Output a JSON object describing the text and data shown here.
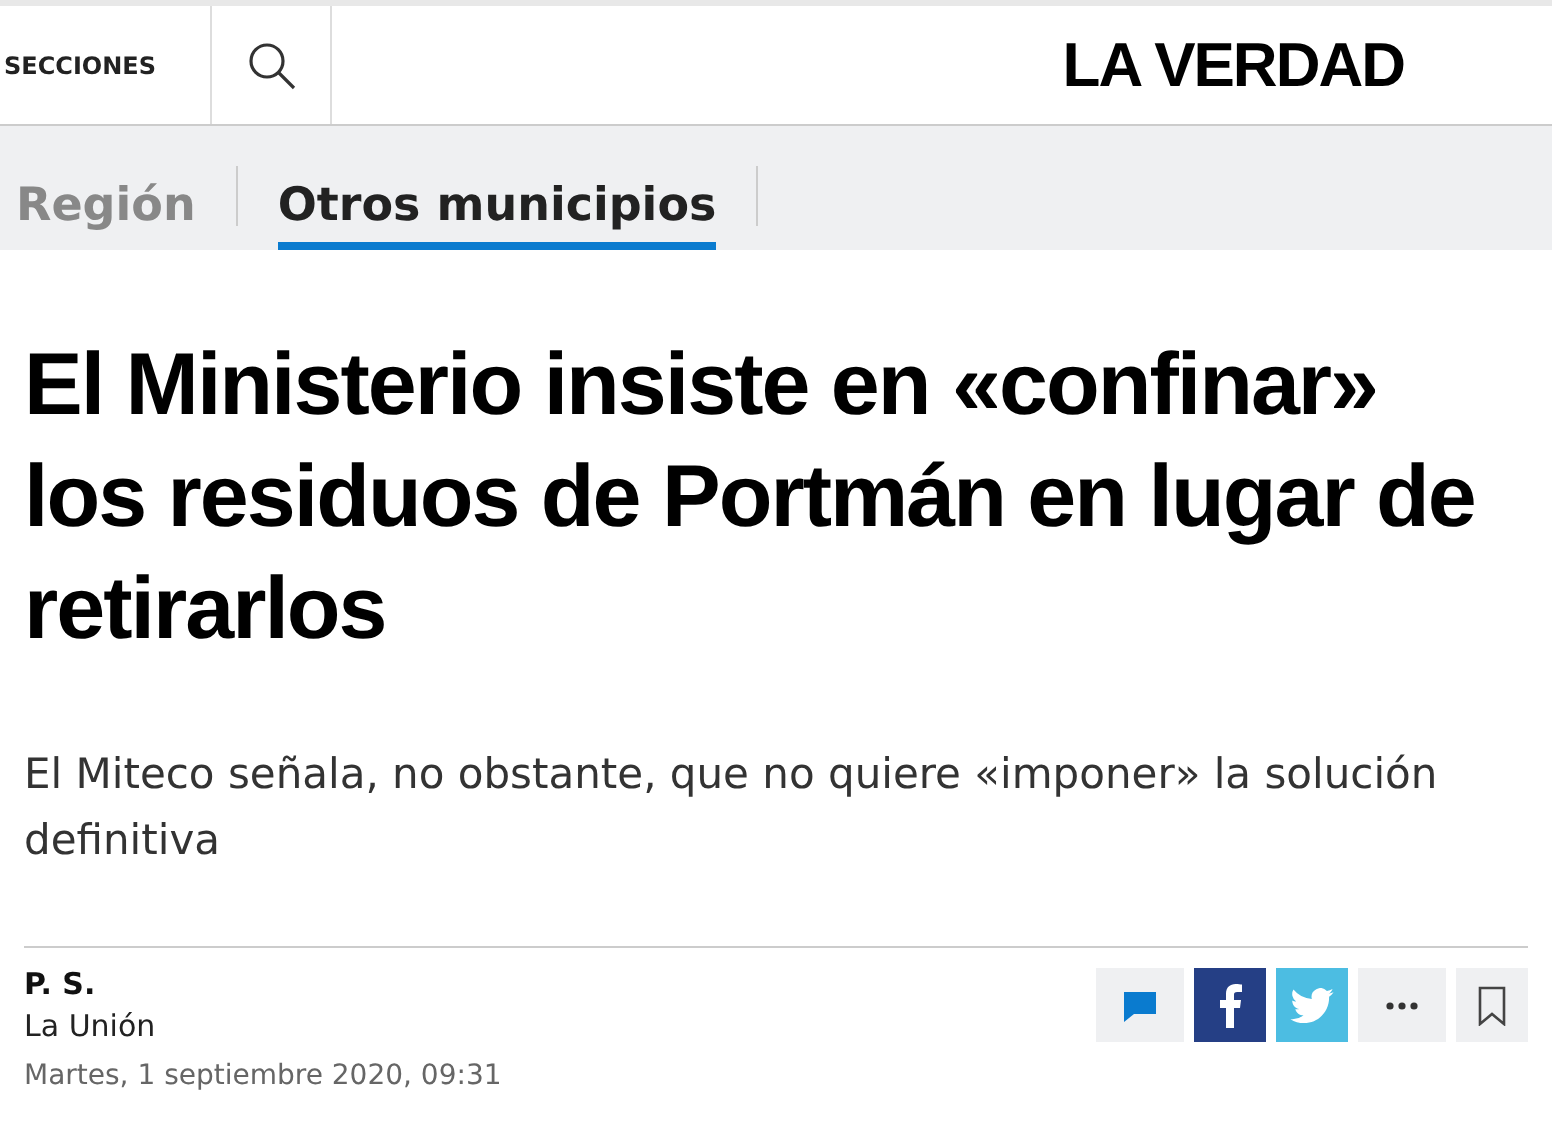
{
  "header": {
    "sections_label": "SECCIONES",
    "logo": "LA VERDAD"
  },
  "tabs": [
    {
      "label": "Región",
      "selected": false
    },
    {
      "label": "Otros municipios",
      "selected": true
    }
  ],
  "article": {
    "headline": "El Ministerio insiste en «confinar» los residuos de Portmán en lugar de retirarlos",
    "subheadline": "El Miteco señala, no obstante, que no quiere «imponer» la solución definitiva",
    "author": "P. S.",
    "location": "La Unión",
    "date": "Martes, 1 septiembre 2020, 09:31"
  },
  "actions": [
    {
      "kind": "comment"
    },
    {
      "kind": "facebook"
    },
    {
      "kind": "twitter"
    },
    {
      "kind": "more"
    },
    {
      "kind": "bookmark"
    }
  ]
}
